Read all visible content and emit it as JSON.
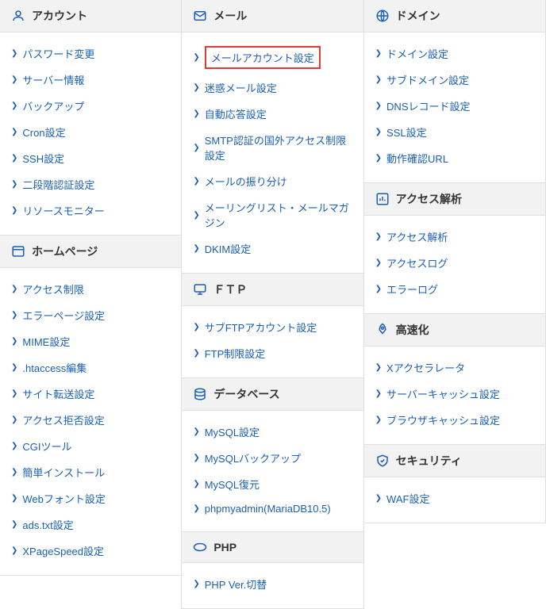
{
  "columns": [
    {
      "sections": [
        {
          "id": "account",
          "title": "アカウント",
          "icon": "user",
          "items": [
            {
              "label": "パスワード変更"
            },
            {
              "label": "サーバー情報"
            },
            {
              "label": "バックアップ"
            },
            {
              "label": "Cron設定"
            },
            {
              "label": "SSH設定"
            },
            {
              "label": "二段階認証設定"
            },
            {
              "label": "リソースモニター"
            }
          ]
        },
        {
          "id": "homepage",
          "title": "ホームページ",
          "icon": "window",
          "items": [
            {
              "label": "アクセス制限"
            },
            {
              "label": "エラーページ設定"
            },
            {
              "label": "MIME設定"
            },
            {
              "label": ".htaccess編集"
            },
            {
              "label": "サイト転送設定"
            },
            {
              "label": "アクセス拒否設定"
            },
            {
              "label": "CGIツール"
            },
            {
              "label": "簡単インストール"
            },
            {
              "label": "Webフォント設定"
            },
            {
              "label": "ads.txt設定"
            },
            {
              "label": "XPageSpeed設定"
            }
          ]
        }
      ]
    },
    {
      "sections": [
        {
          "id": "mail",
          "title": "メール",
          "icon": "mail",
          "items": [
            {
              "label": "メールアカウント設定",
              "highlighted": true
            },
            {
              "label": "迷惑メール設定"
            },
            {
              "label": "自動応答設定"
            },
            {
              "label": "SMTP認証の国外アクセス制限設定"
            },
            {
              "label": "メールの振り分け"
            },
            {
              "label": "メーリングリスト・メールマガジン"
            },
            {
              "label": "DKIM設定"
            }
          ]
        },
        {
          "id": "ftp",
          "title": "ＦＴＰ",
          "icon": "monitor",
          "items": [
            {
              "label": "サブFTPアカウント設定"
            },
            {
              "label": "FTP制限設定"
            }
          ]
        },
        {
          "id": "database",
          "title": "データベース",
          "icon": "database",
          "items": [
            {
              "label": "MySQL設定"
            },
            {
              "label": "MySQLバックアップ"
            },
            {
              "label": "MySQL復元"
            },
            {
              "label": "phpmyadmin(MariaDB10.5)"
            }
          ]
        },
        {
          "id": "php",
          "title": "PHP",
          "icon": "php",
          "items": [
            {
              "label": "PHP Ver.切替"
            }
          ]
        }
      ]
    },
    {
      "sections": [
        {
          "id": "domain",
          "title": "ドメイン",
          "icon": "globe",
          "items": [
            {
              "label": "ドメイン設定"
            },
            {
              "label": "サブドメイン設定"
            },
            {
              "label": "DNSレコード設定"
            },
            {
              "label": "SSL設定"
            },
            {
              "label": "動作確認URL"
            }
          ]
        },
        {
          "id": "access",
          "title": "アクセス解析",
          "icon": "chart",
          "items": [
            {
              "label": "アクセス解析"
            },
            {
              "label": "アクセスログ"
            },
            {
              "label": "エラーログ"
            }
          ]
        },
        {
          "id": "speed",
          "title": "高速化",
          "icon": "rocket",
          "items": [
            {
              "label": "Xアクセラレータ"
            },
            {
              "label": "サーバーキャッシュ設定"
            },
            {
              "label": "ブラウザキャッシュ設定"
            }
          ]
        },
        {
          "id": "security",
          "title": "セキュリティ",
          "icon": "shield",
          "items": [
            {
              "label": "WAF設定"
            }
          ]
        }
      ]
    }
  ]
}
